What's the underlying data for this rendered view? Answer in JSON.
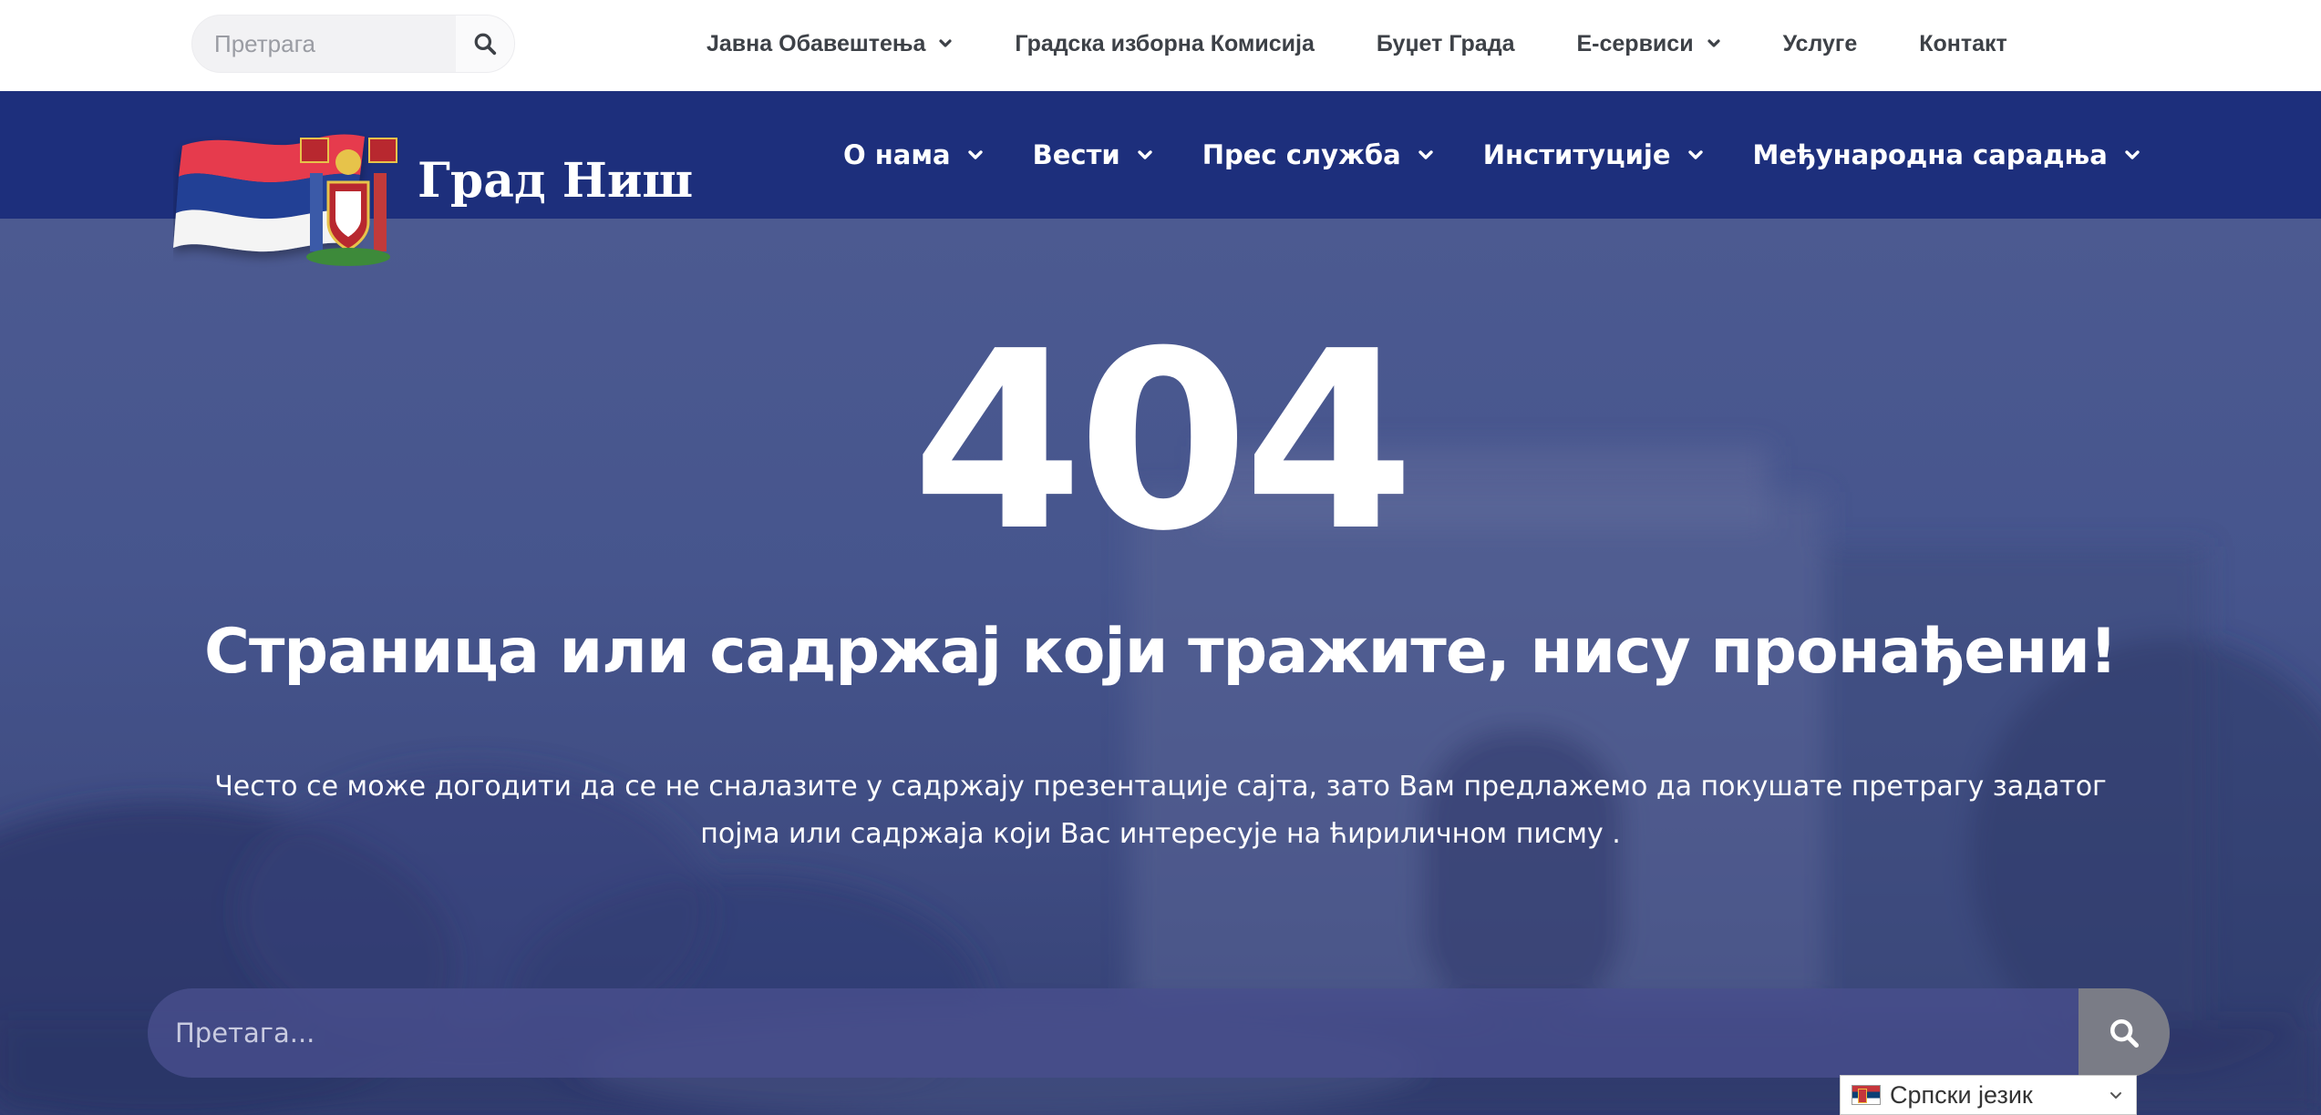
{
  "topbar": {
    "search": {
      "placeholder": "Претрага",
      "icon": "search-icon"
    },
    "nav": [
      {
        "label": "Јавна Обавештења",
        "has_dropdown": true
      },
      {
        "label": "Градска изборна Комисија",
        "has_dropdown": false
      },
      {
        "label": "Буџет Града",
        "has_dropdown": false
      },
      {
        "label": "Е-сервиси",
        "has_dropdown": true
      },
      {
        "label": "Услуге",
        "has_dropdown": false
      },
      {
        "label": "Контакт",
        "has_dropdown": false
      }
    ]
  },
  "header": {
    "site_name": "Град Ниш",
    "nav": [
      {
        "label": "О нама",
        "has_dropdown": true
      },
      {
        "label": "Вести",
        "has_dropdown": true
      },
      {
        "label": "Прес служба",
        "has_dropdown": true
      },
      {
        "label": "Институције",
        "has_dropdown": true
      },
      {
        "label": "Међународна сарадња",
        "has_dropdown": true
      }
    ]
  },
  "error": {
    "code": "404",
    "title": "Страница или садржај који тражите, нису пронађени!",
    "description": "Често  се може догодити да се не сналазите у садржају презентације сајта, зато Вам предлажемо да покушате претрагу задатог појма или садржаја који Вас интересује на ћириличном писму ."
  },
  "hero_search": {
    "placeholder": "Претага...",
    "icon": "search-icon"
  },
  "language_selector": {
    "label": "Српски језик",
    "flag": "serbia-flag-icon"
  },
  "colors": {
    "header_band": "#1d2f7c",
    "hero_overlay": "#46558d",
    "search_button": "#7a7c86",
    "topnav_text": "#3d4147"
  }
}
